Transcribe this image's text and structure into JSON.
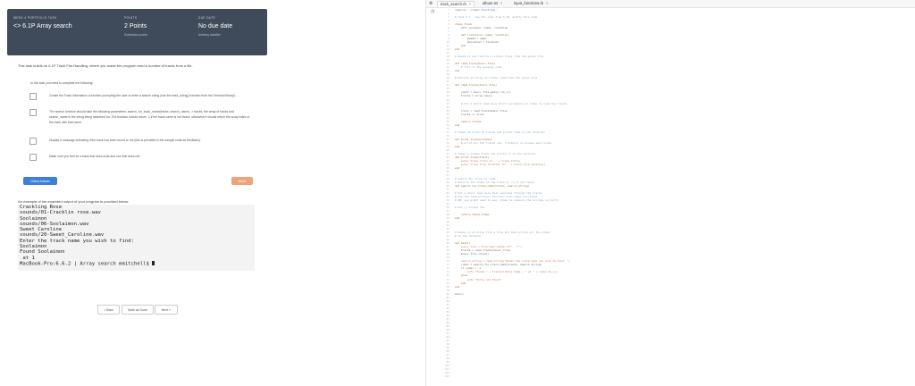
{
  "task_header": {
    "portfolio_label": "WEEK 4 PORTFOLIO TASK",
    "title": "6.1P Array search",
    "points_label": "POINTS",
    "points_value": "2 Points",
    "points_sub": "Submission points",
    "due_label": "DUE DATE",
    "due_value": "No due date",
    "due_sub": "Arbitrary deadline"
  },
  "description": "This task builds on 6.1P Track File-Handling, where you made the program read a number of tracks from a file.",
  "task_card": {
    "intro": "In this task you need to complete the following:",
    "items": [
      "Create the Track information a function prompting the user to enter a search string (use the read_string() function from the Terminal library).",
      "The search function should take the following parameters: search_for_track_name(tracks, search_name) -> tracks, the array of tracks and search_name is the string being searched for. The function should return -1 if the track name is not found, otherwise it should return the array index of the track with that name.",
      "Display a message indicating if the track has been found or not (this is provided in the sample code as feedback).",
      "Make sure you test for a track that does exist and one that does not."
    ],
    "check_button": "Check Answer",
    "reset_button": "Reset"
  },
  "terminal": {
    "caption": "An example of the expected output of your program is provided below:",
    "lines": [
      "Crackling Rose",
      "sounds/01-Cracklin rose.wav",
      "Soolaimon",
      "sounds/06-Soolaimon.wav",
      "Sweet Caroline",
      "sounds/20-Sweet_Caroline.wav",
      "Enter the track name you wish to find:",
      "Soolaimon",
      "Found Soolaimon",
      " at 1",
      "MacBook-Pro:6.6.2 | Array search mmitchell$ "
    ]
  },
  "pager": {
    "back": "< Back",
    "mark_done": "Mark as Done",
    "next": "Next >"
  },
  "editor": {
    "tabs": [
      {
        "label": "track_search.rb",
        "active": true
      },
      {
        "label": "album.txt",
        "active": false
      },
      {
        "label": "input_functions.rb",
        "active": false
      }
    ],
    "close_glyph": "×",
    "line_count": 103,
    "code": [
      [
        1,
        0,
        "require './input_functions'",
        "fn"
      ],
      [
        3,
        0,
        "# Task 6.1 - Use the code from 5.1P, modify this code",
        "cm"
      ],
      [
        5,
        0,
        "class Track",
        "kw"
      ],
      [
        6,
        2,
        "attr_accessor :name, :location",
        ""
      ],
      [
        8,
        2,
        "def initialize (name, location)",
        "kw"
      ],
      [
        9,
        4,
        "@name = name",
        ""
      ],
      [
        10,
        4,
        "@location = location",
        ""
      ],
      [
        11,
        2,
        "end",
        "kw"
      ],
      [
        12,
        0,
        "end",
        "kw"
      ],
      [
        14,
        0,
        "# Reads in and returns a single track from the given file",
        "cm"
      ],
      [
        16,
        0,
        "def read_track(music_file)",
        "kw"
      ],
      [
        17,
        2,
        "# fill in the missing code",
        "cm"
      ],
      [
        18,
        0,
        "end",
        "kw"
      ],
      [
        20,
        0,
        "# Returns an array of tracks read from the given file",
        "cm"
      ],
      [
        22,
        0,
        "def read_tracks(music_file)",
        "kw"
      ],
      [
        24,
        2,
        "count = music_file.gets().to_i()",
        ""
      ],
      [
        25,
        2,
        "tracks = Array.new()",
        ""
      ],
      [
        27,
        2,
        "# Put a while loop here which increments an index to read the tracks",
        "cm"
      ],
      [
        29,
        2,
        "track = read_track(music_file)",
        ""
      ],
      [
        30,
        2,
        "tracks << track",
        ""
      ],
      [
        32,
        2,
        "return tracks",
        "kw"
      ],
      [
        33,
        0,
        "end",
        "kw"
      ],
      [
        35,
        0,
        "# Takes an array of tracks and prints them to the terminal",
        "cm"
      ],
      [
        37,
        0,
        "def print_tracks(tracks)",
        "kw"
      ],
      [
        38,
        2,
        "# print all the tracks use: tracks[x] to access each track.",
        "cm"
      ],
      [
        39,
        0,
        "end",
        "kw"
      ],
      [
        41,
        0,
        "# Takes a single track and prints it to the terminal",
        "cm"
      ],
      [
        42,
        0,
        "def print_track(track)",
        "kw"
      ],
      [
        43,
        2,
        "puts('Track title is: ' + track.title)",
        "st"
      ],
      [
        44,
        2,
        "puts('Track file location is: ' + track.file_location)",
        "st"
      ],
      [
        45,
        0,
        "end",
        "kw"
      ],
      [
        48,
        0,
        "# search for track by name.",
        "cm"
      ],
      [
        49,
        0,
        "# Returns the index of the track or -1 if not found",
        "cm"
      ],
      [
        50,
        0,
        "def search_for_track_name(tracks, search_string)",
        "kw"
      ],
      [
        52,
        0,
        "# Put a while loop here that searches through the tracks",
        "cm"
      ],
      [
        53,
        0,
        "# Use the read_string() function from input_functions.",
        "cm"
      ],
      [
        54,
        0,
        "# NB: you might need to use .chomp to compare the strings correctly",
        "cm"
      ],
      [
        56,
        0,
        "# Put () around the",
        "cm"
      ],
      [
        58,
        2,
        "return found_index",
        "kw"
      ],
      [
        59,
        0,
        "end",
        "kw"
      ],
      [
        63,
        0,
        "# Reads in an Album from a file and then prints all the album",
        "cm"
      ],
      [
        64,
        0,
        "# to the terminal",
        "cm"
      ],
      [
        66,
        0,
        "def main()",
        "kw"
      ],
      [
        67,
        2,
        "music_file = File.new(\"album.txt\", \"r\")",
        "st"
      ],
      [
        68,
        2,
        "tracks = read_tracks(music_file)",
        ""
      ],
      [
        69,
        2,
        "music_file.close()",
        ""
      ],
      [
        71,
        2,
        "search_string = read_string(\"Enter the track name you wish to find: \")",
        "st"
      ],
      [
        72,
        2,
        "index = search_for_track_name(tracks, search_string)",
        ""
      ],
      [
        73,
        2,
        "if index > -1",
        "kw"
      ],
      [
        74,
        4,
        "puts \"Found \" + tracks[index].name + \" at \" + index.to_s()",
        "st"
      ],
      [
        75,
        2,
        "else",
        "kw"
      ],
      [
        76,
        4,
        "puts \"Entry not Found\"",
        "st"
      ],
      [
        77,
        2,
        "end",
        "kw"
      ],
      [
        78,
        0,
        "end",
        "kw"
      ],
      [
        80,
        0,
        "main()",
        "fn"
      ]
    ]
  }
}
